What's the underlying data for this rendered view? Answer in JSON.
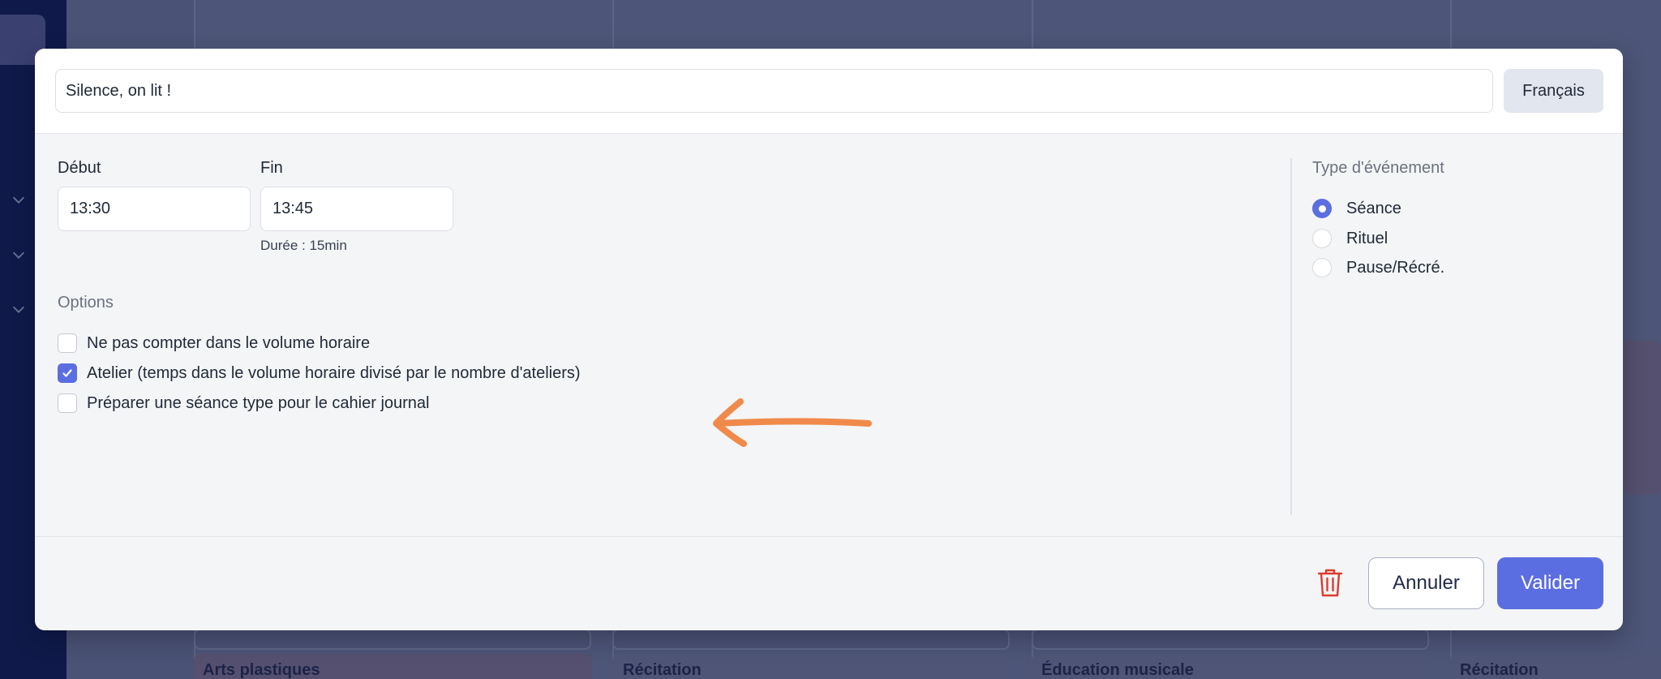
{
  "background": {
    "column_labels": [
      "Arts plastiques",
      "Récitation",
      "Éducation musicale",
      "Récitation"
    ]
  },
  "event_form": {
    "title_value": "Silence, on lit !",
    "language_label": "Français",
    "start": {
      "label": "Début",
      "value": "13:30"
    },
    "end": {
      "label": "Fin",
      "value": "13:45"
    },
    "duration_text": "Durée : 15min",
    "options": {
      "label": "Options",
      "items": [
        {
          "label": "Ne pas compter dans le volume horaire",
          "checked": false
        },
        {
          "label": "Atelier (temps dans le volume horaire divisé par le nombre d'ateliers)",
          "checked": true
        },
        {
          "label": "Préparer une séance type pour le cahier journal",
          "checked": false
        }
      ]
    },
    "event_type": {
      "label": "Type d'événement",
      "items": [
        {
          "label": "Séance",
          "selected": true
        },
        {
          "label": "Rituel",
          "selected": false
        },
        {
          "label": "Pause/Récré.",
          "selected": false
        }
      ]
    },
    "footer": {
      "delete_icon": "trash-icon",
      "cancel_label": "Annuler",
      "submit_label": "Valider"
    }
  },
  "annotation": {
    "icon": "arrow-left-icon",
    "color": "#f08a4b"
  },
  "colors": {
    "accent": "#5b6ee1",
    "danger": "#dc3b2f",
    "overlay": "#4a5275"
  }
}
